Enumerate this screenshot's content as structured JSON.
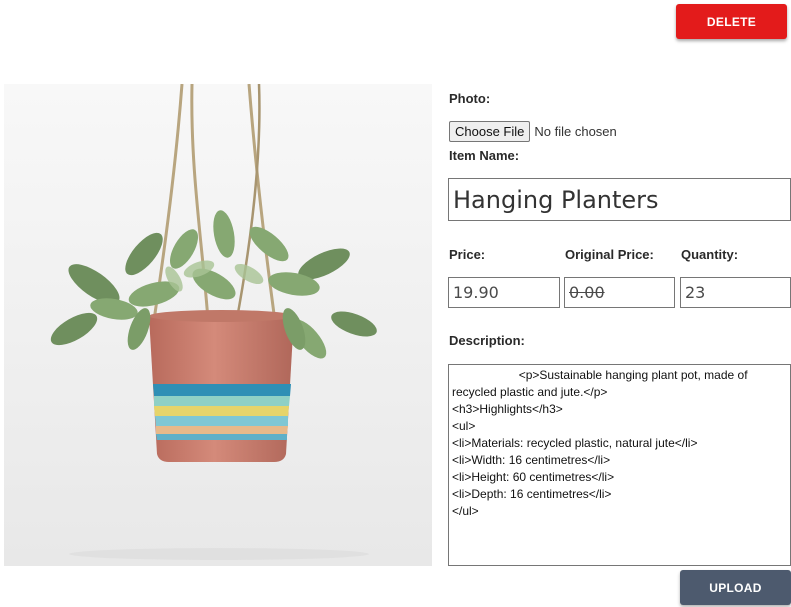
{
  "actions": {
    "delete_label": "DELETE",
    "upload_label": "UPLOAD"
  },
  "colors": {
    "delete_button": "#e31b1b",
    "upload_button": "#4d5a6e",
    "pot": "#c97a6a"
  },
  "photo": {
    "image": "hanging-planter-photo",
    "label": "Photo:",
    "choose_file_label": "Choose File",
    "file_status": "No file chosen"
  },
  "item_name": {
    "label": "Item Name:",
    "value": "Hanging Planters"
  },
  "price": {
    "label": "Price:",
    "value": "19.90"
  },
  "original_price": {
    "label": "Original Price:",
    "value": "0.00"
  },
  "quantity": {
    "label": "Quantity:",
    "value": "23"
  },
  "description": {
    "label": "Description:",
    "value": "                    <p>Sustainable hanging plant pot, made of recycled plastic and jute.</p>\n<h3>Highlights</h3>\n<ul>\n<li>Materials: recycled plastic, natural jute</li>\n<li>Width: 16 centimetres</li>\n<li>Height: 60 centimetres</li>\n<li>Depth: 16 centimetres</li>\n</ul>"
  }
}
